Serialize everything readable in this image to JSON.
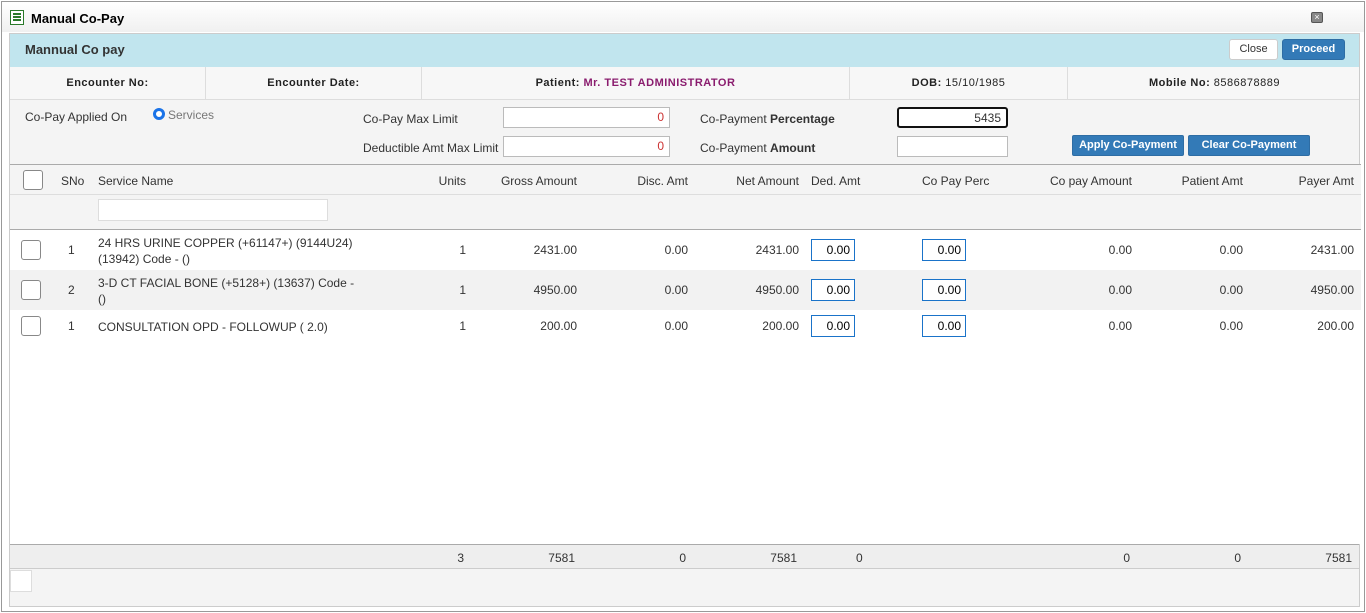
{
  "window": {
    "title": "Manual Co-Pay"
  },
  "header": {
    "title": "Mannual Co pay",
    "close_label": "Close",
    "proceed_label": "Proceed"
  },
  "info": {
    "encounter_no_label": "Encounter No:",
    "encounter_date_label": "Encounter Date:",
    "patient_label": "Patient:",
    "patient_value": "Mr. TEST ADMINISTRATOR",
    "dob_label": "DOB:",
    "dob_value": "15/10/1985",
    "mobile_label": "Mobile No:",
    "mobile_value": "8586878889"
  },
  "form": {
    "applied_on_label": "Co-Pay Applied On",
    "applied_on_option": "Services",
    "max_limit_label": "Co-Pay Max Limit",
    "max_limit_value": "0",
    "deductible_label": "Deductible Amt Max Limit",
    "deductible_value": "0",
    "percentage_label_a": "Co-Payment",
    "percentage_label_b": "Percentage",
    "percentage_value": "5435",
    "amount_label_a": "Co-Payment",
    "amount_label_b": "Amount",
    "amount_value": "",
    "apply_label": "Apply Co-Payment",
    "clear_label": "Clear Co-Payment"
  },
  "table": {
    "columns": [
      "SNo",
      "Service Name",
      "Units",
      "Gross Amount",
      "Disc. Amt",
      "Net Amount",
      "Ded. Amt",
      "Co Pay Perc",
      "Co pay Amount",
      "Patient Amt",
      "Payer Amt"
    ],
    "filter_value": "",
    "rows": [
      {
        "sno": "1",
        "name": "24 HRS URINE COPPER (+61147+) (9144U24) (13942) Code - ()",
        "units": "1",
        "gross": "2431.00",
        "disc": "0.00",
        "net": "2431.00",
        "ded": "0.00",
        "perc": "0.00",
        "copay": "0.00",
        "patient": "0.00",
        "payer": "2431.00"
      },
      {
        "sno": "2",
        "name": "3-D CT FACIAL BONE (+5128+) (13637) Code - ()",
        "units": "1",
        "gross": "4950.00",
        "disc": "0.00",
        "net": "4950.00",
        "ded": "0.00",
        "perc": "0.00",
        "copay": "0.00",
        "patient": "0.00",
        "payer": "4950.00"
      },
      {
        "sno": "1",
        "name": "CONSULTATION OPD - FOLLOWUP ( 2.0)",
        "units": "1",
        "gross": "200.00",
        "disc": "0.00",
        "net": "200.00",
        "ded": "0.00",
        "perc": "0.00",
        "copay": "0.00",
        "patient": "0.00",
        "payer": "200.00"
      }
    ],
    "totals": {
      "units": "3",
      "gross": "7581",
      "disc": "0",
      "net": "7581",
      "ded": "0",
      "copay": "0",
      "patient": "0",
      "payer": "7581"
    }
  }
}
